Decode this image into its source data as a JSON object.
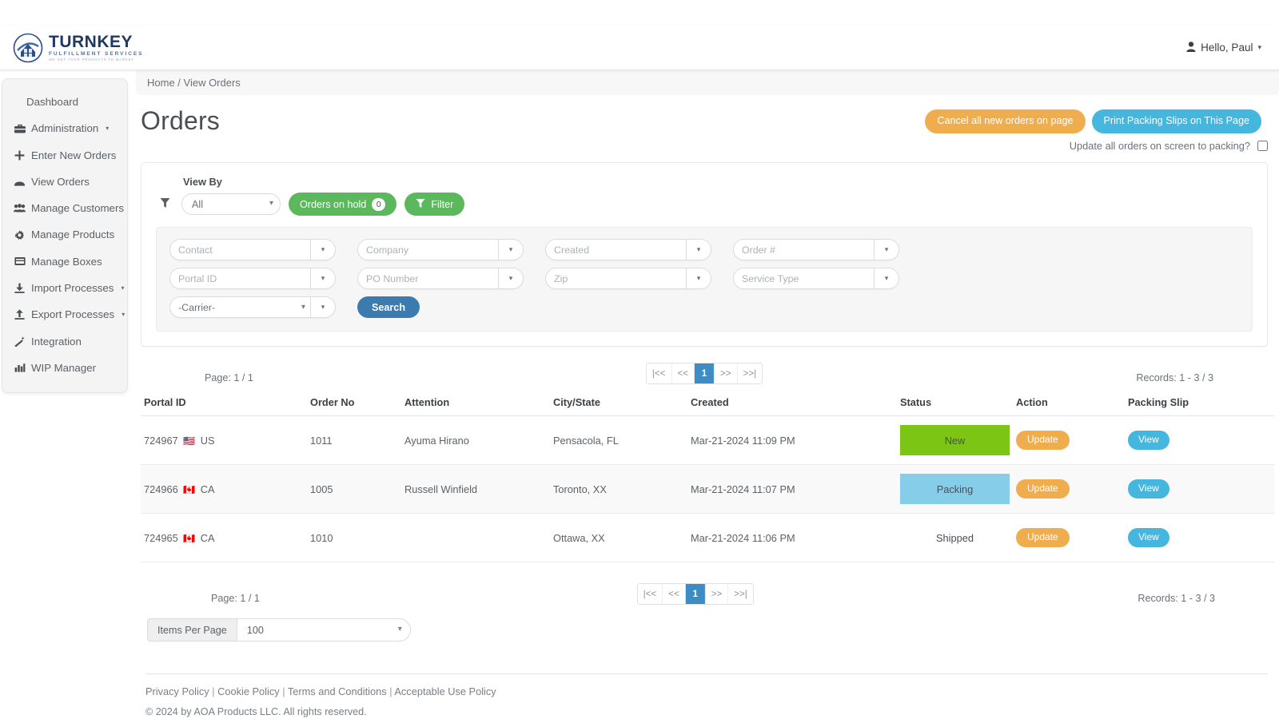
{
  "brand": {
    "title": "TURNKEY",
    "subtitle": "FULFILLMENT SERVICES",
    "tagline": "WE GET YOUR PRODUCTS TO MARKET",
    "logo_icon": "house-shield-logo-icon",
    "brand_color": "#1f3864"
  },
  "navbar": {
    "user_icon": "user-icon",
    "user_greeting": "Hello, Paul",
    "caret": "▾"
  },
  "sidebar": {
    "items": [
      {
        "label": "Dashboard",
        "icon": "",
        "caret": ""
      },
      {
        "label": "Administration",
        "icon": "briefcase-icon",
        "caret": "▾"
      },
      {
        "label": "Enter New Orders",
        "icon": "plus-icon",
        "caret": ""
      },
      {
        "label": "View Orders",
        "icon": "inbox-icon",
        "caret": ""
      },
      {
        "label": "Manage Customers",
        "icon": "users-icon",
        "caret": ""
      },
      {
        "label": "Manage Products",
        "icon": "gear-icon",
        "caret": ""
      },
      {
        "label": "Manage Boxes",
        "icon": "box-icon",
        "caret": ""
      },
      {
        "label": "Import Processes",
        "icon": "download-icon",
        "caret": "▾"
      },
      {
        "label": "Export Processes",
        "icon": "upload-icon",
        "caret": "▾"
      },
      {
        "label": "Integration",
        "icon": "magic-wand-icon",
        "caret": ""
      },
      {
        "label": "WIP Manager",
        "icon": "bar-chart-icon",
        "caret": ""
      }
    ]
  },
  "breadcrumb": "Home / View Orders",
  "page": {
    "title": "Orders",
    "cancel_button": "Cancel all new orders on page",
    "print_button": "Print Packing Slips on This Page",
    "update_all_label": "Update all orders on screen to packing?",
    "update_all_checked": false
  },
  "filters": {
    "view_by_label": "View By",
    "funnel_icon": "funnel-icon",
    "view_by_value": "All",
    "view_by_options": [
      "All"
    ],
    "orders_on_hold_label": "Orders on hold",
    "orders_on_hold_count": "0",
    "filter_button": "Filter",
    "filter_button_icon": "funnel-icon",
    "fields": [
      {
        "name": "contact",
        "placeholder": "Contact",
        "value": ""
      },
      {
        "name": "company",
        "placeholder": "Company",
        "value": ""
      },
      {
        "name": "created",
        "placeholder": "Created",
        "value": ""
      },
      {
        "name": "order-no",
        "placeholder": "Order #",
        "value": ""
      },
      {
        "name": "portal-id",
        "placeholder": "Portal ID",
        "value": ""
      },
      {
        "name": "po-number",
        "placeholder": "PO Number",
        "value": ""
      },
      {
        "name": "zip",
        "placeholder": "Zip",
        "value": ""
      },
      {
        "name": "service-type",
        "placeholder": "Service Type",
        "value": ""
      }
    ],
    "carrier_value": "-Carrier-",
    "carrier_options": [
      "-Carrier-"
    ],
    "search_button": "Search"
  },
  "pager_top": {
    "page_text": "Page: 1 / 1",
    "first": "|<<",
    "prev": "<<",
    "current": "1",
    "next": ">>",
    "last": ">>|",
    "records_text": "Records: 1 - 3 / 3"
  },
  "pager_bottom": {
    "page_text": "Page: 1 / 1",
    "first": "|<<",
    "prev": "<<",
    "current": "1",
    "next": ">>",
    "last": ">>|",
    "records_text": "Records: 1 - 3 / 3"
  },
  "table": {
    "columns": [
      "Portal ID",
      "Order No",
      "Attention",
      "City/State",
      "Created",
      "Status",
      "Action",
      "Packing Slip"
    ],
    "rows": [
      {
        "portal_id": "724967",
        "flag": "🇺🇸",
        "country": "US",
        "order_no": "1011",
        "attention": "Ayuma Hirano",
        "city_state": "Pensacola, FL",
        "created": "Mar-21-2024  11:09 PM",
        "status": "New",
        "status_color": "#7cc514",
        "action_label": "Update",
        "packing_label": "View"
      },
      {
        "portal_id": "724966",
        "flag": "🇨🇦",
        "country": "CA",
        "order_no": "1005",
        "attention": "Russell Winfield",
        "city_state": "Toronto, XX",
        "created": "Mar-21-2024  11:07 PM",
        "status": "Packing",
        "status_color": "#86cdea",
        "action_label": "Update",
        "packing_label": "View"
      },
      {
        "portal_id": "724965",
        "flag": "🇨🇦",
        "country": "CA",
        "order_no": "1010",
        "attention": "",
        "city_state": "Ottawa, XX",
        "created": "Mar-21-2024  11:06 PM",
        "status": "Shipped",
        "status_color": "transparent",
        "action_label": "Update",
        "packing_label": "View"
      }
    ]
  },
  "items_per_page": {
    "label": "Items Per Page",
    "value": "100",
    "options": [
      "100"
    ]
  },
  "footer": {
    "links": [
      "Privacy Policy",
      "Cookie Policy",
      "Terms and Conditions",
      "Acceptable Use Policy"
    ],
    "separator": "|",
    "copyright": "© 2024 by AOA Products LLC. All rights reserved."
  },
  "colors": {
    "orange": "#f0ad4e",
    "cyan": "#45b6dd",
    "green": "#5cb85c",
    "blue": "#3c7bb0",
    "pager_active": "#3c8dc5"
  }
}
